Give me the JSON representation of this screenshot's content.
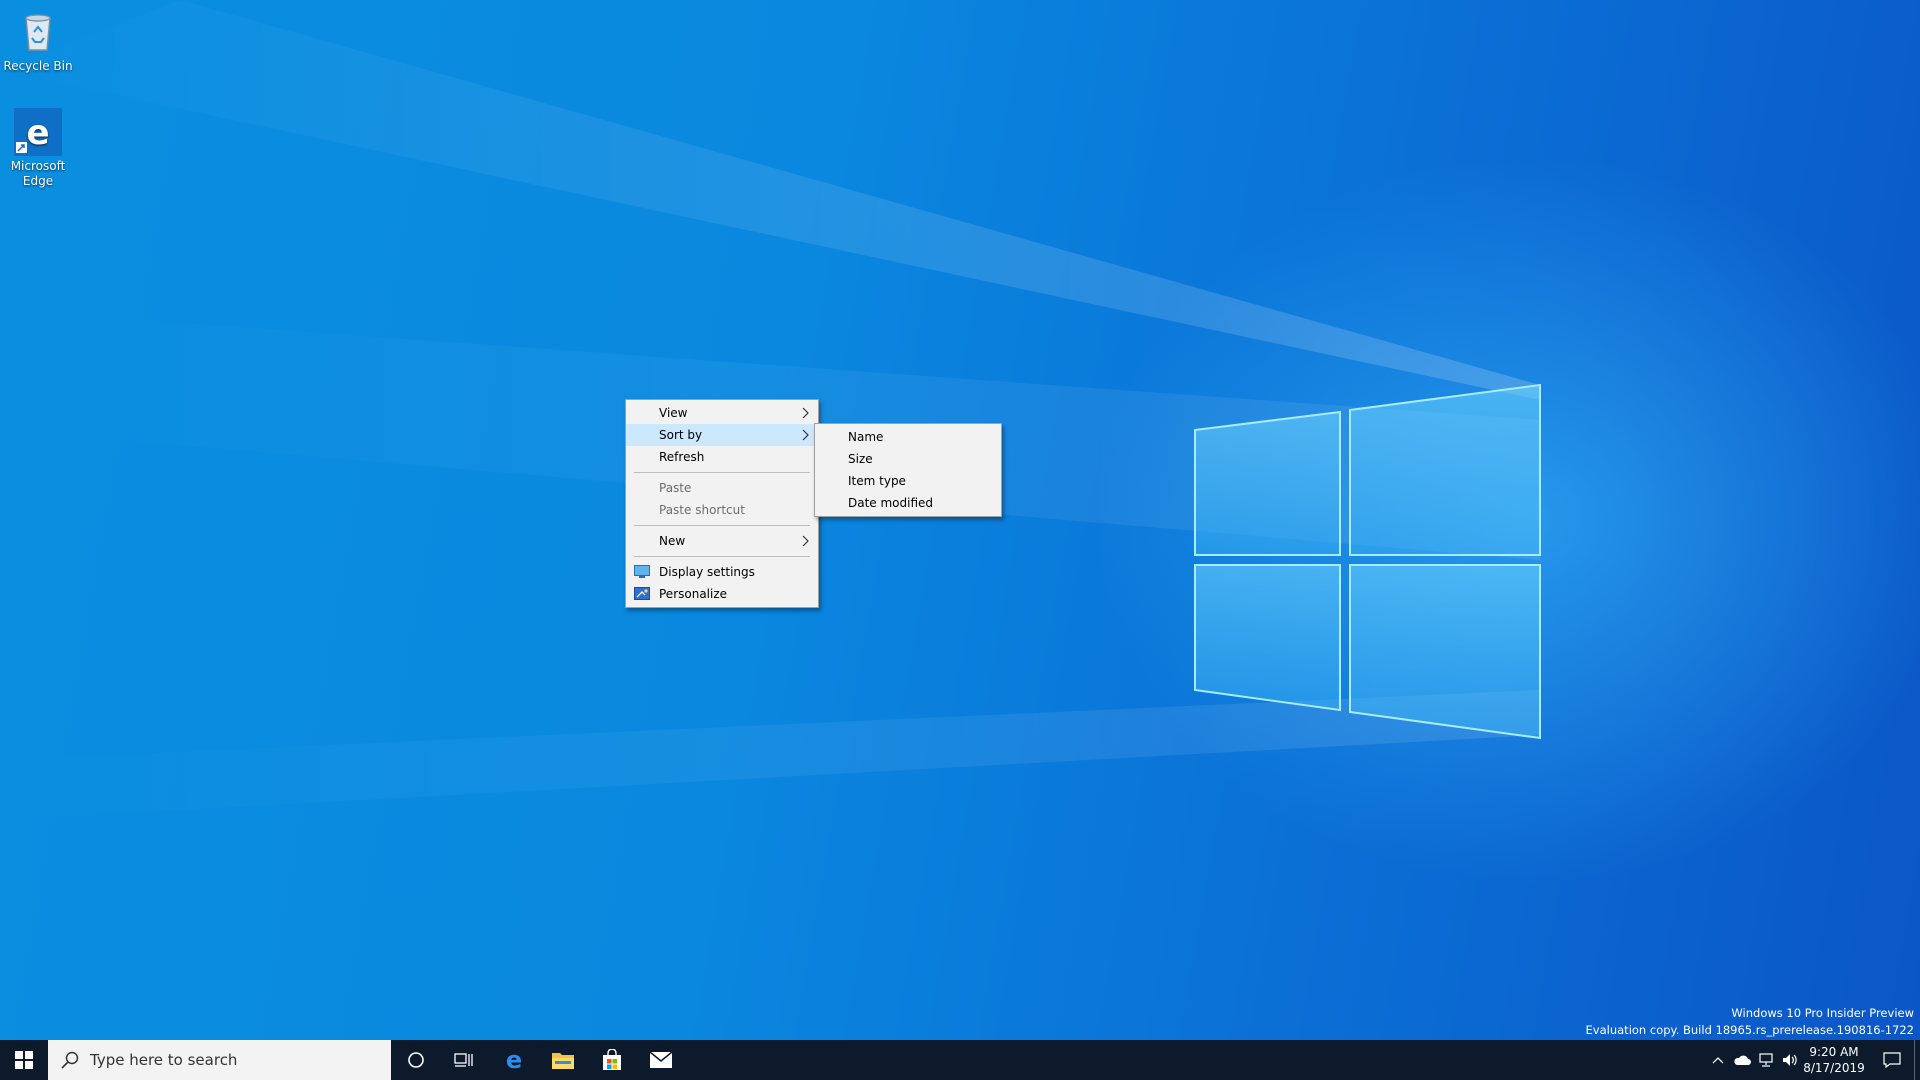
{
  "desktop": {
    "icons": [
      {
        "label": "Recycle Bin"
      },
      {
        "label": "Microsoft Edge"
      }
    ]
  },
  "context_menu": {
    "items": {
      "view": "View",
      "sort_by": "Sort by",
      "refresh": "Refresh",
      "paste": "Paste",
      "paste_shortcut": "Paste shortcut",
      "new": "New",
      "display_settings": "Display settings",
      "personalize": "Personalize"
    }
  },
  "sort_submenu": {
    "items": [
      "Name",
      "Size",
      "Item type",
      "Date modified"
    ]
  },
  "watermark": {
    "line1": "Windows 10 Pro Insider Preview",
    "line2": "Evaluation copy. Build 18965.rs_prerelease.190816-1722"
  },
  "taskbar": {
    "search_placeholder": "Type here to search",
    "clock_time": "9:20 AM",
    "clock_date": "8/17/2019"
  },
  "colors": {
    "taskbar_bg": "#0d1a2c",
    "menu_bg": "#f2f2f2",
    "highlight": "#cce8ff",
    "accent": "#0078d7"
  }
}
